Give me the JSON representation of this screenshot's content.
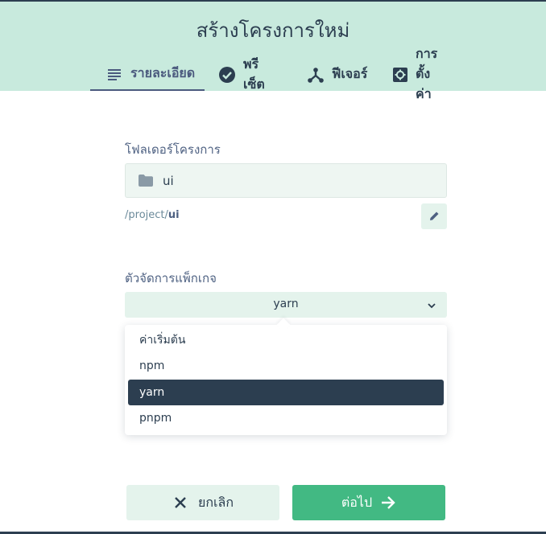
{
  "header": {
    "title": "สร้างโครงการใหม่",
    "tabs": [
      {
        "label": "รายละเอียด",
        "icon": "details-icon",
        "active": true
      },
      {
        "label": "พรีเซ็ต",
        "icon": "check-circle-icon",
        "active": false
      },
      {
        "label": "ฟีเจอร์",
        "icon": "merge-icon",
        "active": false
      },
      {
        "label": "การตั้งค่า",
        "icon": "settings-icon",
        "active": false
      }
    ]
  },
  "folder": {
    "label": "โฟลเดอร์โครงการ",
    "value": "ui",
    "path_prefix": "/project/",
    "path_name": "ui"
  },
  "package_manager": {
    "label": "ตัวจัดการแพ็กเกจ",
    "selected": "yarn",
    "options": [
      "ค่าเริ่มต้น",
      "npm",
      "yarn",
      "pnpm"
    ]
  },
  "actions": {
    "cancel": "ยกเลิก",
    "next": "ต่อไป"
  },
  "colors": {
    "header_bg": "#c8eadd",
    "accent": "#42b983",
    "dark": "#2c3e50",
    "tab_active": "#4b5a7e"
  }
}
